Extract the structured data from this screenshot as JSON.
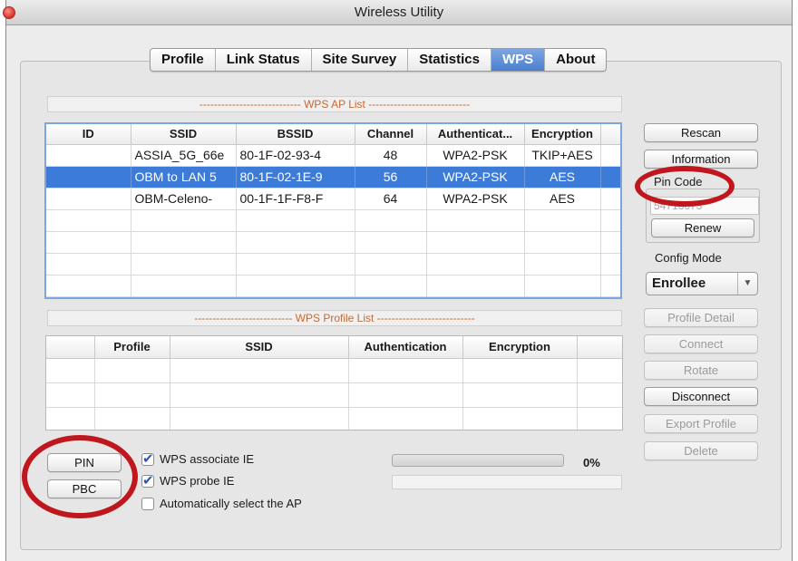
{
  "window": {
    "title": "Wireless Utility"
  },
  "tabs": [
    "Profile",
    "Link Status",
    "Site Survey",
    "Statistics",
    "WPS",
    "About"
  ],
  "active_tab": "WPS",
  "ap_list": {
    "label": "---------------------------- WPS AP List ----------------------------",
    "columns": [
      "ID",
      "SSID",
      "BSSID",
      "Channel",
      "Authenticat...",
      "Encryption"
    ],
    "rows": [
      {
        "id": "",
        "ssid": "ASSIA_5G_66e",
        "bssid": "80-1F-02-93-4",
        "channel": "48",
        "auth": "WPA2-PSK",
        "enc": "TKIP+AES"
      },
      {
        "id": "",
        "ssid": "OBM to LAN 5",
        "bssid": "80-1F-02-1E-9",
        "channel": "56",
        "auth": "WPA2-PSK",
        "enc": "AES"
      },
      {
        "id": "",
        "ssid": "OBM-Celeno-",
        "bssid": "00-1F-1F-F8-F",
        "channel": "64",
        "auth": "WPA2-PSK",
        "enc": "AES"
      }
    ],
    "selected_row": 1
  },
  "profile_list": {
    "label": "--------------------------- WPS Profile List ---------------------------",
    "columns": [
      "",
      "Profile",
      "SSID",
      "Authentication",
      "Encryption"
    ]
  },
  "right_buttons": {
    "rescan": "Rescan",
    "information": "Information",
    "pin_code_label": "Pin Code",
    "pin_code_value": "54713673",
    "renew": "Renew",
    "config_mode_label": "Config Mode",
    "config_mode_value": "Enrollee",
    "profile_detail": "Profile Detail",
    "connect": "Connect",
    "rotate": "Rotate",
    "disconnect": "Disconnect",
    "export_profile": "Export Profile",
    "delete": "Delete"
  },
  "bottom": {
    "pin": "PIN",
    "pbc": "PBC",
    "wps_associate_ie": "WPS associate IE",
    "wps_probe_ie": "WPS probe IE",
    "auto_select_ap": "Automatically select the AP",
    "progress_percent": 0,
    "progress_text": "0%"
  },
  "colors": {
    "accent": "#3d7bd8",
    "highlight_ring": "#c0161e",
    "section_label": "#c9692f"
  }
}
